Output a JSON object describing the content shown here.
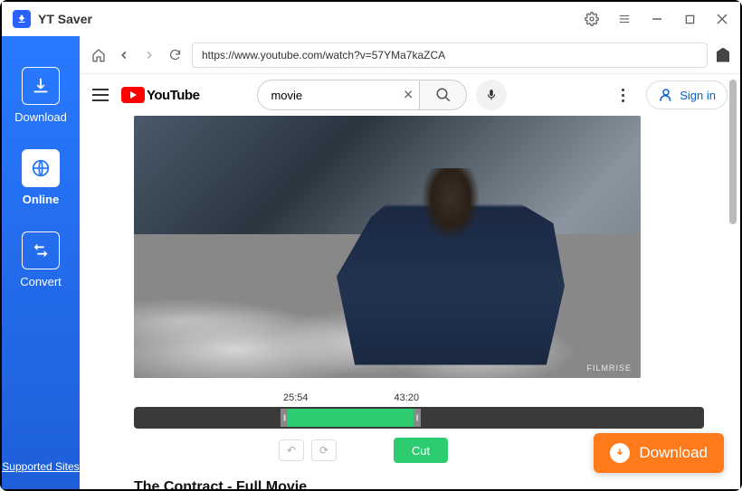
{
  "app": {
    "title": "YT Saver"
  },
  "sidebar": {
    "items": [
      {
        "label": "Download"
      },
      {
        "label": "Online"
      },
      {
        "label": "Convert"
      }
    ],
    "supported_sites": "Supported Sites"
  },
  "browser": {
    "url": "https://www.youtube.com/watch?v=57YMa7kaZCA"
  },
  "youtube": {
    "logo_text": "YouTube",
    "search_value": "movie",
    "signin_label": "Sign in"
  },
  "video": {
    "watermark": "FILMRISE",
    "title": "The Contract - Full Movie"
  },
  "timeline": {
    "start_label": "25:54",
    "end_label": "43:20",
    "cut_label": "Cut"
  },
  "download_button": {
    "label": "Download"
  }
}
